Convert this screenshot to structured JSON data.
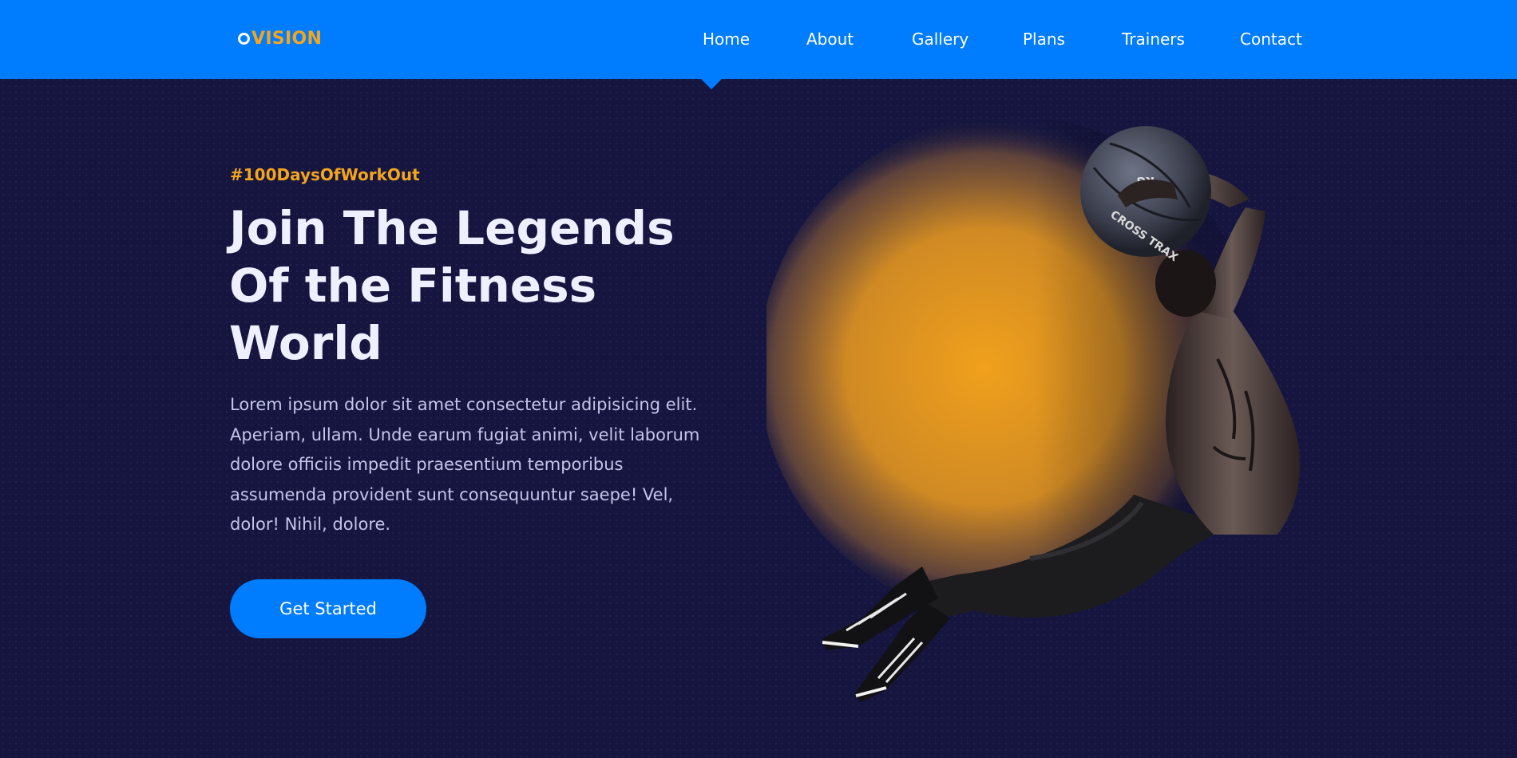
{
  "brand": {
    "logo_text": "VISION",
    "logo_mark": "O"
  },
  "nav": {
    "items": [
      {
        "label": "Home",
        "active": true
      },
      {
        "label": "About"
      },
      {
        "label": "Gallery"
      },
      {
        "label": "Plans"
      },
      {
        "label": "Trainers"
      },
      {
        "label": "Contact"
      }
    ]
  },
  "hero": {
    "hashtag": "#100DaysOfWorkOut",
    "title_lines": [
      "Join The Legends",
      "Of the Fitness",
      "World"
    ],
    "description": "Lorem ipsum dolor sit amet consectetur adipisicing elit. Aperiam, ullam. Unde earum fugiat animi, velit laborum dolore officiis impedit praesentium temporibus assumenda provident sunt consequuntur saepe! Vel, dolor! Nihil, dolore.",
    "cta_label": "Get Started",
    "ball_text": "CROSS TRAX",
    "ball_weight": "KG"
  },
  "colors": {
    "nav_bg": "#007cff",
    "page_bg": "#15153f",
    "accent_orange": "#f4a51c",
    "title_text": "#eef0ff",
    "body_text": "#c4c5ea",
    "button_bg": "#007cff"
  },
  "icons": {
    "logo_mark": "ring-icon",
    "nav_indicator": "triangle-down-icon"
  }
}
